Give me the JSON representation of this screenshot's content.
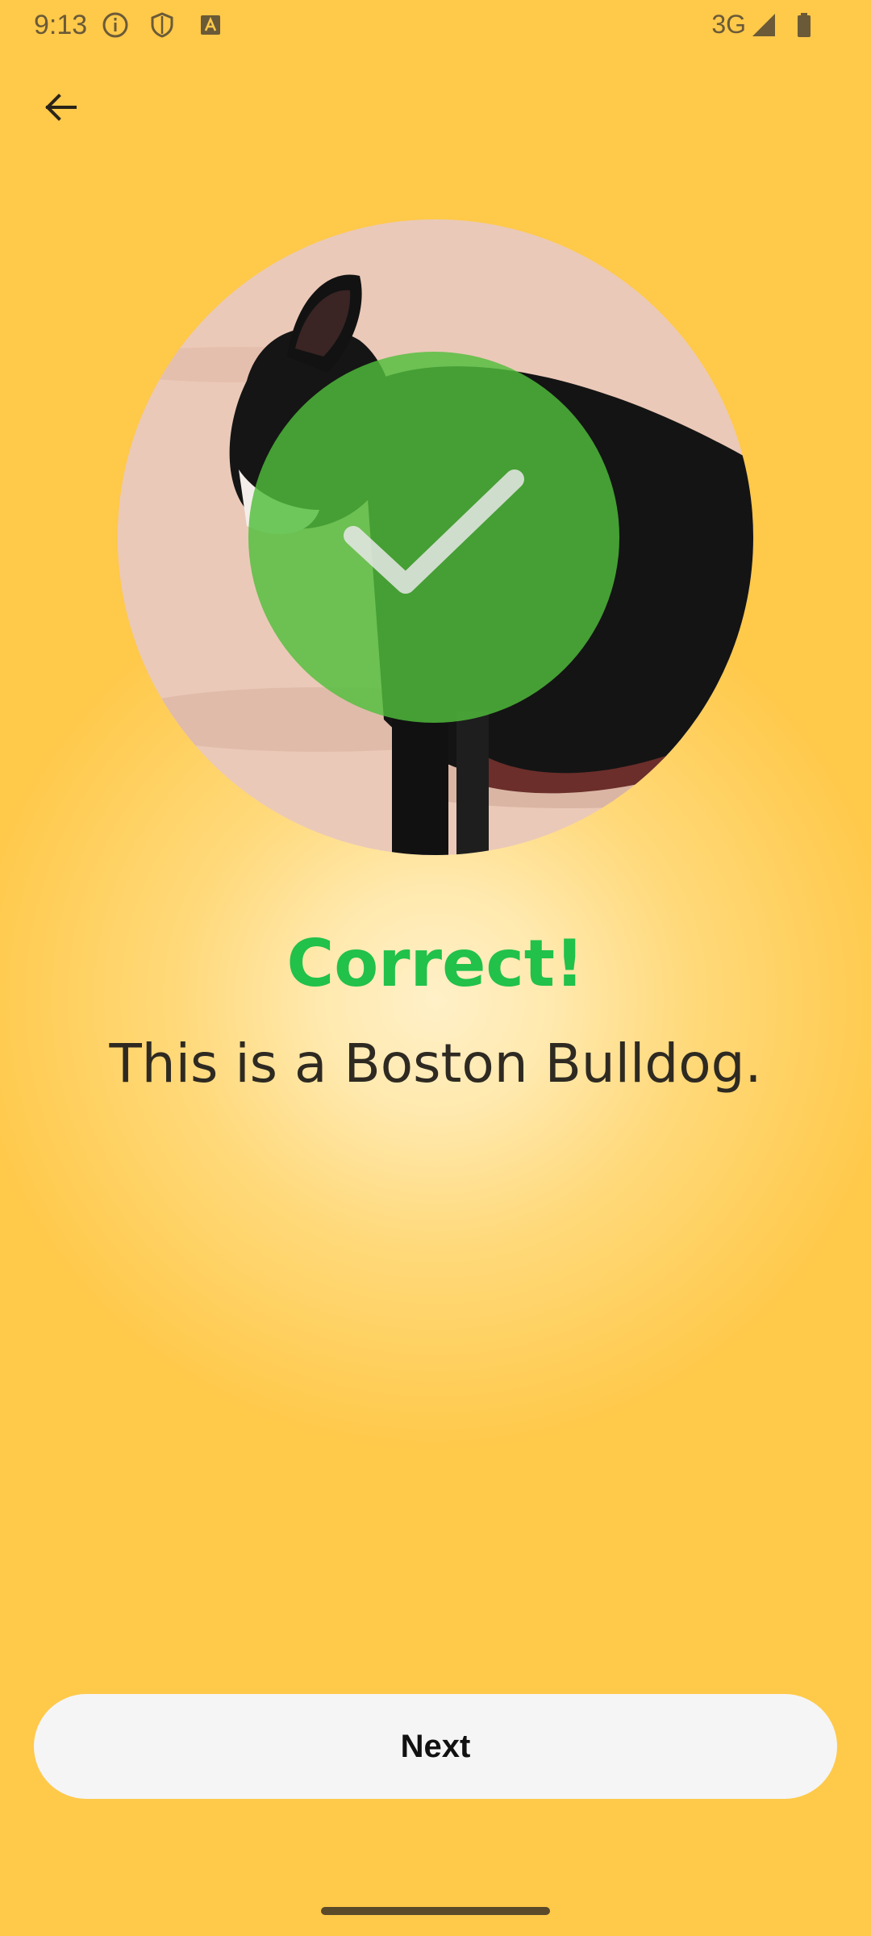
{
  "status_bar": {
    "time": "9:13",
    "network": "3G",
    "icons": [
      "info-icon",
      "shield-icon",
      "text-a-icon",
      "signal-icon",
      "battery-icon"
    ]
  },
  "header": {
    "back_icon": "arrow-left-icon"
  },
  "quiz": {
    "result_title": "Correct!",
    "result_text": "This is a Boston Bulldog.",
    "result_icon": "checkmark-icon"
  },
  "actions": {
    "next_label": "Next"
  },
  "colors": {
    "background": "#FFC94A",
    "success": "#21C14A",
    "check_overlay": "#50BE3C",
    "button_bg": "#F5F5F5"
  }
}
